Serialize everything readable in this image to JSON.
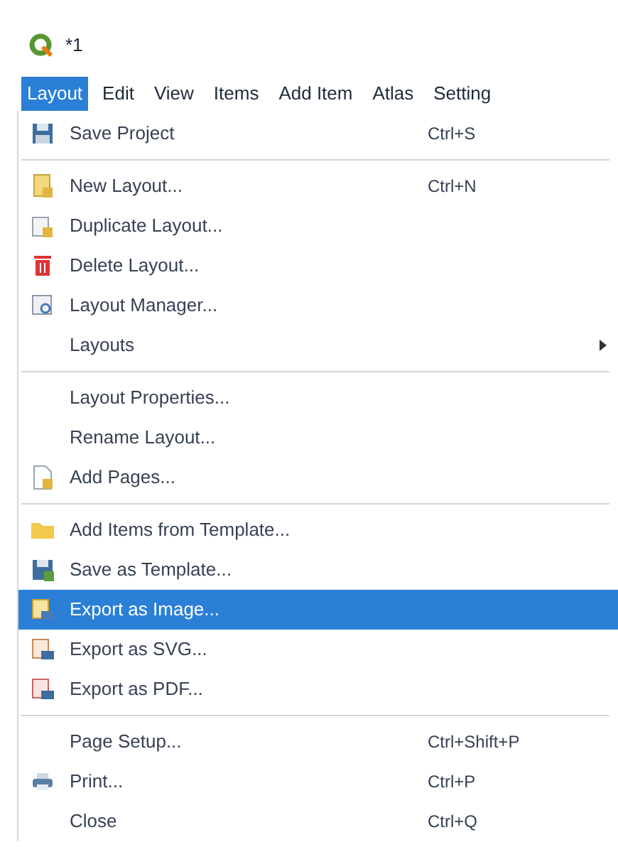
{
  "window": {
    "title": "*1"
  },
  "menubar": [
    {
      "label": "Layout",
      "selected": true
    },
    {
      "label": "Edit",
      "selected": false
    },
    {
      "label": "View",
      "selected": false
    },
    {
      "label": "Items",
      "selected": false
    },
    {
      "label": "Add Item",
      "selected": false
    },
    {
      "label": "Atlas",
      "selected": false
    },
    {
      "label": "Setting",
      "selected": false
    }
  ],
  "menu": [
    {
      "kind": "item",
      "label": "Save Project",
      "shortcut": "Ctrl+S",
      "selected": false
    },
    {
      "kind": "separator"
    },
    {
      "kind": "item",
      "label": "New Layout...",
      "shortcut": "Ctrl+N",
      "selected": false
    },
    {
      "kind": "item",
      "label": "Duplicate Layout...",
      "selected": false
    },
    {
      "kind": "item",
      "label": "Delete Layout...",
      "selected": false
    },
    {
      "kind": "item",
      "label": "Layout Manager...",
      "selected": false
    },
    {
      "kind": "submenu",
      "label": "Layouts",
      "selected": false
    },
    {
      "kind": "separator"
    },
    {
      "kind": "item",
      "label": "Layout Properties...",
      "selected": false
    },
    {
      "kind": "item",
      "label": "Rename Layout...",
      "selected": false
    },
    {
      "kind": "item",
      "label": "Add Pages...",
      "selected": false
    },
    {
      "kind": "separator"
    },
    {
      "kind": "item",
      "label": "Add Items from Template...",
      "selected": false
    },
    {
      "kind": "item",
      "label": "Save as Template...",
      "selected": false
    },
    {
      "kind": "item",
      "label": "Export as Image...",
      "selected": true
    },
    {
      "kind": "item",
      "label": "Export as SVG...",
      "selected": false
    },
    {
      "kind": "item",
      "label": "Export as PDF...",
      "selected": false
    },
    {
      "kind": "separator"
    },
    {
      "kind": "item",
      "label": "Page Setup...",
      "shortcut": "Ctrl+Shift+P",
      "selected": false
    },
    {
      "kind": "item",
      "label": "Print...",
      "shortcut": "Ctrl+P",
      "selected": false
    },
    {
      "kind": "item",
      "label": "Close",
      "shortcut": "Ctrl+Q",
      "selected": false
    }
  ]
}
